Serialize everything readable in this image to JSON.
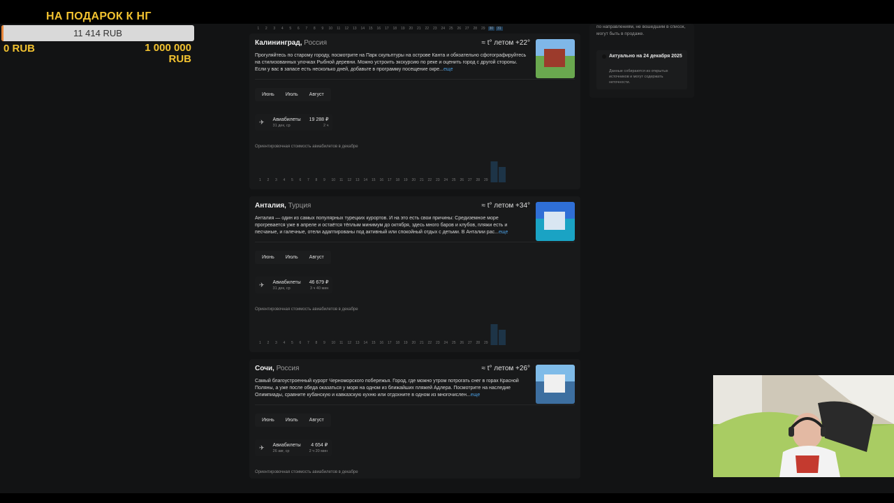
{
  "donation": {
    "title": "НА ПОДАРОК К НГ",
    "current": "11 414 RUB",
    "progress_fraction": 0.0114,
    "min": "0 RUB",
    "max": "1 000 000 RUB",
    "colors": {
      "title": "#f2c230",
      "fill": "#e7863a"
    }
  },
  "days": [
    "1",
    "2",
    "3",
    "4",
    "5",
    "6",
    "7",
    "8",
    "9",
    "10",
    "11",
    "12",
    "13",
    "14",
    "15",
    "16",
    "17",
    "18",
    "19",
    "20",
    "21",
    "22",
    "23",
    "24",
    "25",
    "26",
    "27",
    "28",
    "29",
    "30",
    "31"
  ],
  "cards": [
    {
      "city": "Калининград,",
      "country": "Россия",
      "temp": "≈ t° летом +22°",
      "description": "Прогуляйтесь по старому городу, посмотрите на Парк скульптуры на острове Канта и обязательно сфотографируйтесь на стилизованных улочках Рыбной деревни. Можно устроить экскурсию по реке и оценить город с другой стороны. Если у вас в запасе есть несколько дней, добавьте в программу посещение окре...",
      "more": "еще",
      "tabs": [
        "Июнь",
        "Июль",
        "Август"
      ],
      "offer": {
        "label": "Авиабилеты",
        "date": "31 дек, ср",
        "price": "19 288 ₽",
        "duration": "2 ч"
      },
      "note": "Ориентировочная стоимость авиабилетов в декабре"
    },
    {
      "city": "Анталия,",
      "country": "Турция",
      "temp": "≈ t° летом +34°",
      "description": "Анталия — один из самых популярных турецких курортов. И на это есть свои причины: Средиземное море прогревается уже в апреле и остаётся тёплым минимум до октября, здесь много баров и клубов, пляжи есть и песчаные, и галечные, отели адаптированы под активный или спокойный отдых с детьми. В Анталии рас...",
      "more": "еще",
      "tabs": [
        "Июнь",
        "Июль",
        "Август"
      ],
      "offer": {
        "label": "Авиабилеты",
        "date": "31 дек, ср",
        "price": "46 679 ₽",
        "duration": "3 ч 40 мин"
      },
      "note": "Ориентировочная стоимость авиабилетов в декабре"
    },
    {
      "city": "Сочи,",
      "country": "Россия",
      "temp": "≈ t° летом +26°",
      "description": "Самый благоустроенный курорт Черноморского побережья. Город, где можно утром потрогать снег в горах Красной Поляны, а уже после обеда оказаться у моря на одном из ближайших пляжей Адлера. Посмотрите на наследие Олимпиады, сравните кубанскую и кавказскую кухню или отдохните в одном из многочислен...",
      "more": "еще",
      "tabs": [
        "Июнь",
        "Июль",
        "Август"
      ],
      "offer": {
        "label": "Авиабилеты",
        "date": "26 авг, ср",
        "price": "4 654 ₽",
        "duration": "2 ч 20 мин"
      },
      "note": "Ориентировочная стоимость авиабилетов в декабре"
    }
  ],
  "sidebar": {
    "intro": "по направлениям, не вошедшим в список, могут быть в продаже.",
    "info_title": "Актуально на 24 декабря 2025",
    "info_text": "Данные собираются из открытых источников и могут содержать неточности."
  }
}
